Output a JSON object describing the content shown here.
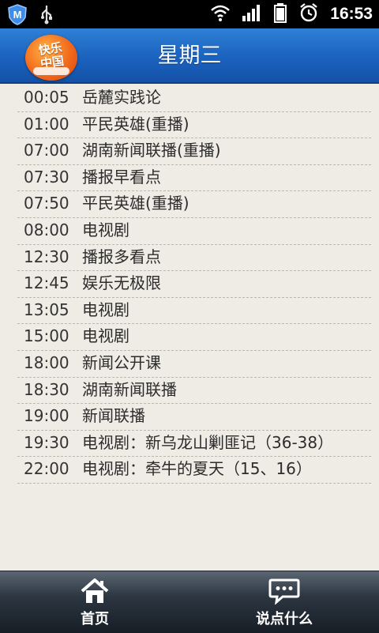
{
  "status_bar": {
    "time": "16:53",
    "icons": [
      "app-m-icon",
      "usb-icon",
      "wifi-icon",
      "signal-icon",
      "battery-icon",
      "alarm-icon"
    ]
  },
  "header": {
    "title": "星期三",
    "logo_text_line1": "快乐",
    "logo_text_line2": "中国"
  },
  "schedule": [
    {
      "time": "00:05",
      "program": "岳麓实践论"
    },
    {
      "time": "01:00",
      "program": "平民英雄(重播)"
    },
    {
      "time": "07:00",
      "program": "湖南新闻联播(重播)"
    },
    {
      "time": "07:30",
      "program": "播报早看点"
    },
    {
      "time": "07:50",
      "program": "平民英雄(重播)"
    },
    {
      "time": "08:00",
      "program": "电视剧"
    },
    {
      "time": "12:30",
      "program": "播报多看点"
    },
    {
      "time": "12:45",
      "program": "娱乐无极限"
    },
    {
      "time": "13:05",
      "program": "电视剧"
    },
    {
      "time": "15:00",
      "program": "电视剧"
    },
    {
      "time": "18:00",
      "program": "新闻公开课"
    },
    {
      "time": "18:30",
      "program": "湖南新闻联播"
    },
    {
      "time": "19:00",
      "program": "新闻联播"
    },
    {
      "time": "19:30",
      "program": "电视剧：新乌龙山剿匪记（36-38）"
    },
    {
      "time": "22:00",
      "program": "电视剧：牵牛的夏天（15、16）"
    }
  ],
  "bottom_nav": {
    "home_label": "首页",
    "comment_label": "说点什么"
  },
  "colors": {
    "header_blue": "#1a62be",
    "background": "#efece6",
    "nav_dark": "#2d3742"
  }
}
